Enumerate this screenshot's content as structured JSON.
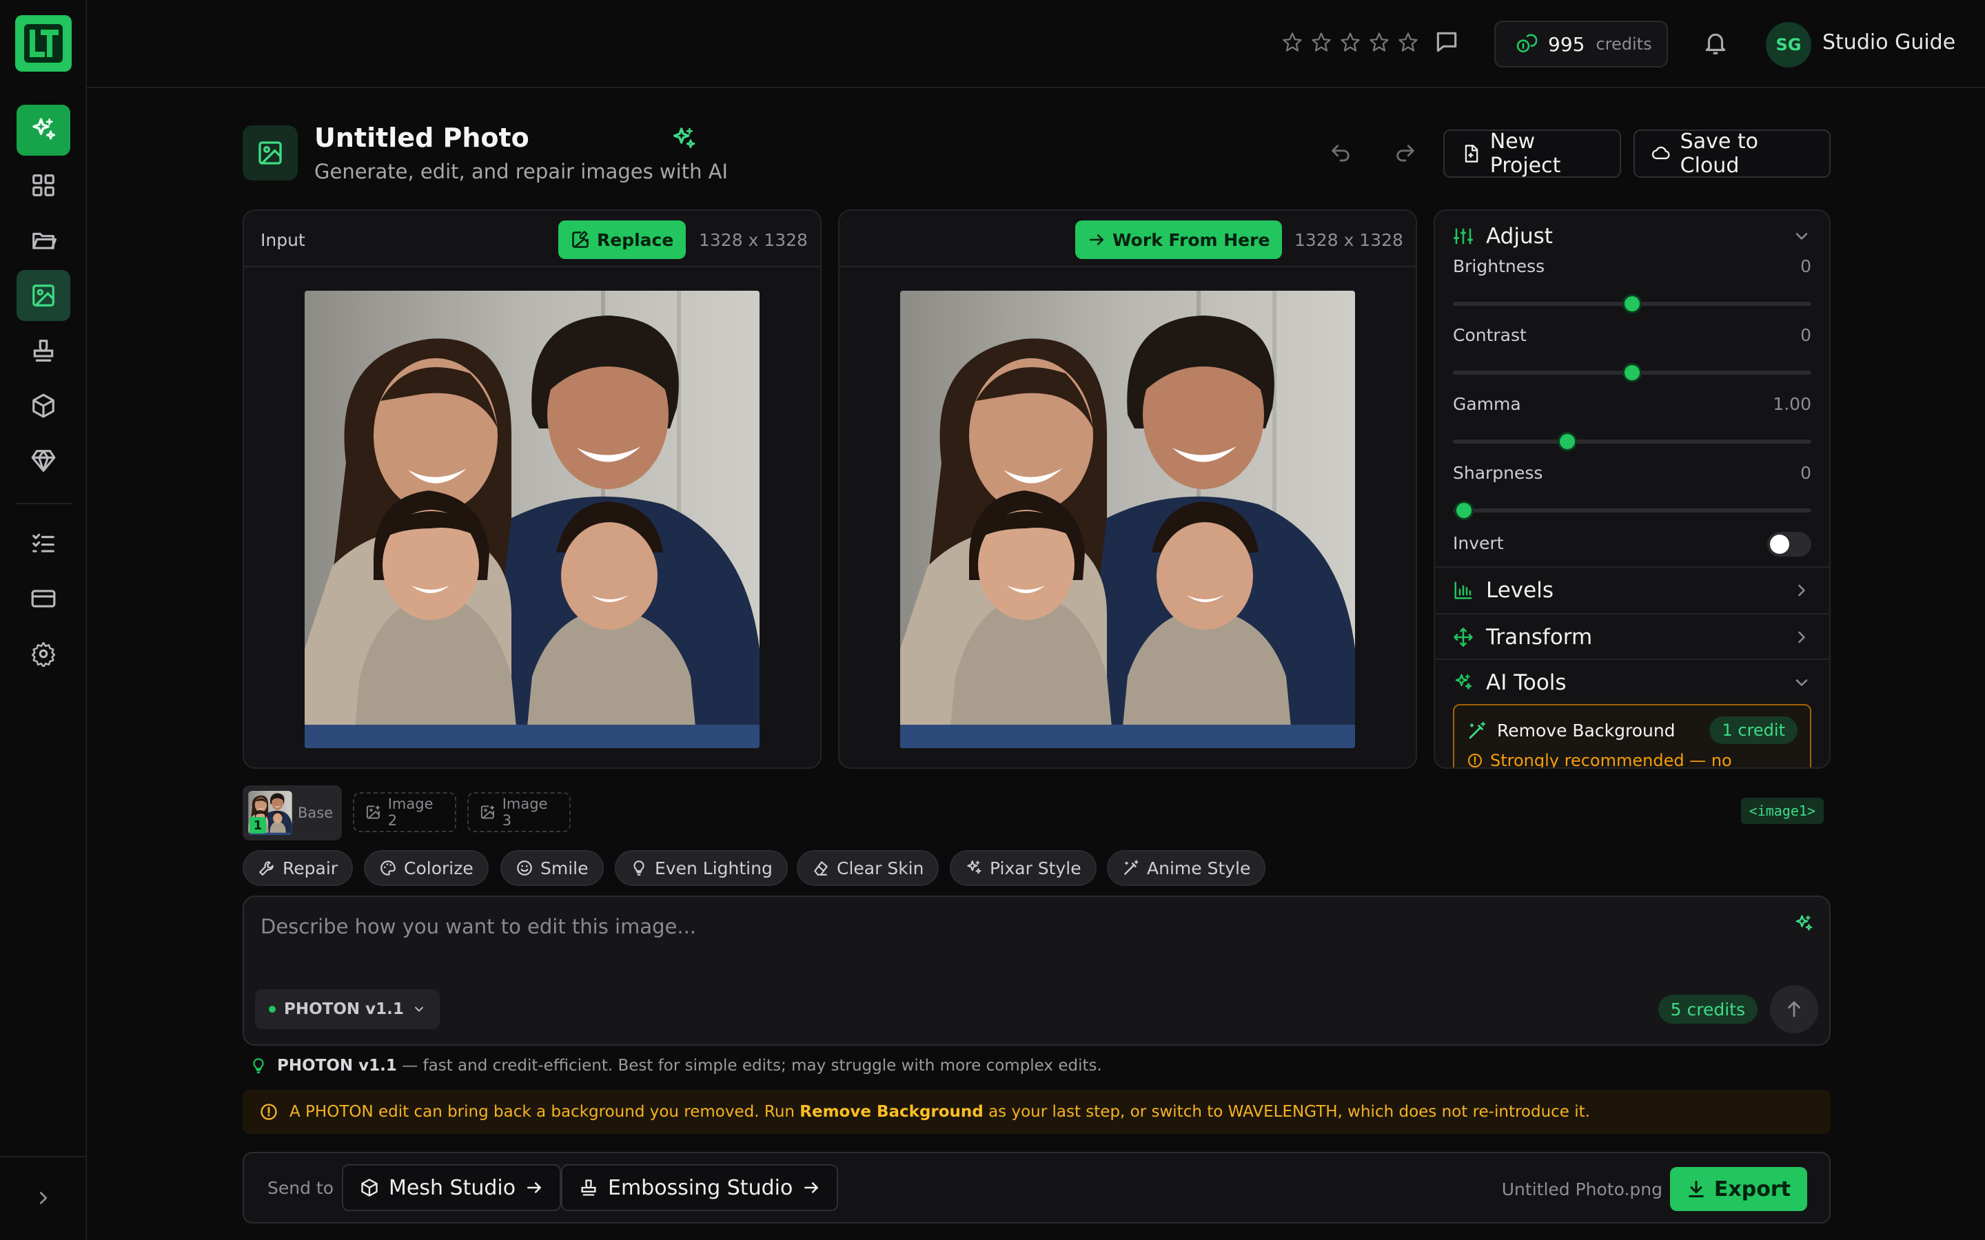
{
  "app": {
    "logo_text": "LT"
  },
  "topbar": {
    "credits_value": "995",
    "credits_label": "credits",
    "user_initials": "SG",
    "user_name": "Studio Guide",
    "rating_stars": 5
  },
  "header": {
    "title": "Untitled Photo",
    "subtitle": "Generate, edit, and repair images with AI",
    "new_project_label": "New Project",
    "save_cloud_label": "Save to Cloud"
  },
  "input_panel": {
    "label": "Input",
    "replace_label": "Replace",
    "dims": "1328 x 1328"
  },
  "output_panel": {
    "work_from_here_label": "Work From Here",
    "dims": "1328 x 1328"
  },
  "adjust": {
    "title": "Adjust",
    "sliders": [
      {
        "label": "Brightness",
        "value": "0",
        "fraction": 0.5
      },
      {
        "label": "Contrast",
        "value": "0",
        "fraction": 0.5
      },
      {
        "label": "Gamma",
        "value": "1.00",
        "fraction": 0.32
      },
      {
        "label": "Sharpness",
        "value": "0",
        "fraction": 0.03
      }
    ],
    "invert_label": "Invert",
    "invert_on": false,
    "levels_title": "Levels",
    "transform_title": "Transform",
    "ai_tools_title": "AI Tools",
    "remove_bg_label": "Remove Background",
    "remove_bg_cost": "1 credit",
    "remove_bg_warning": "Strongly recommended — no"
  },
  "slots": {
    "base_label": "Base",
    "base_number": "1",
    "image2_label": "Image 2",
    "image3_label": "Image 3",
    "tag": "<image1>"
  },
  "chips": [
    "Repair",
    "Colorize",
    "Smile",
    "Even Lighting",
    "Clear Skin",
    "Pixar Style",
    "Anime Style"
  ],
  "prompt": {
    "placeholder": "Describe how you want to edit this image...",
    "model": "PHOTON v1.1",
    "cost": "5 credits"
  },
  "model_note": {
    "name": "PHOTON v1.1",
    "text": "— fast and credit-efficient. Best for simple edits; may struggle with more complex edits."
  },
  "warning": {
    "pre": "A PHOTON edit can bring back a background you removed. Run",
    "bold": "Remove Background",
    "post": "as your last step, or switch to WAVELENGTH, which does not re-introduce it."
  },
  "send_bar": {
    "label": "Send to",
    "mesh_label": "Mesh Studio",
    "emboss_label": "Embossing Studio",
    "filename": "Untitled Photo.png",
    "export_label": "Export"
  },
  "colors": {
    "accent": "#22c55e",
    "warning": "#f59e0b",
    "background": "#0b0b0c"
  }
}
